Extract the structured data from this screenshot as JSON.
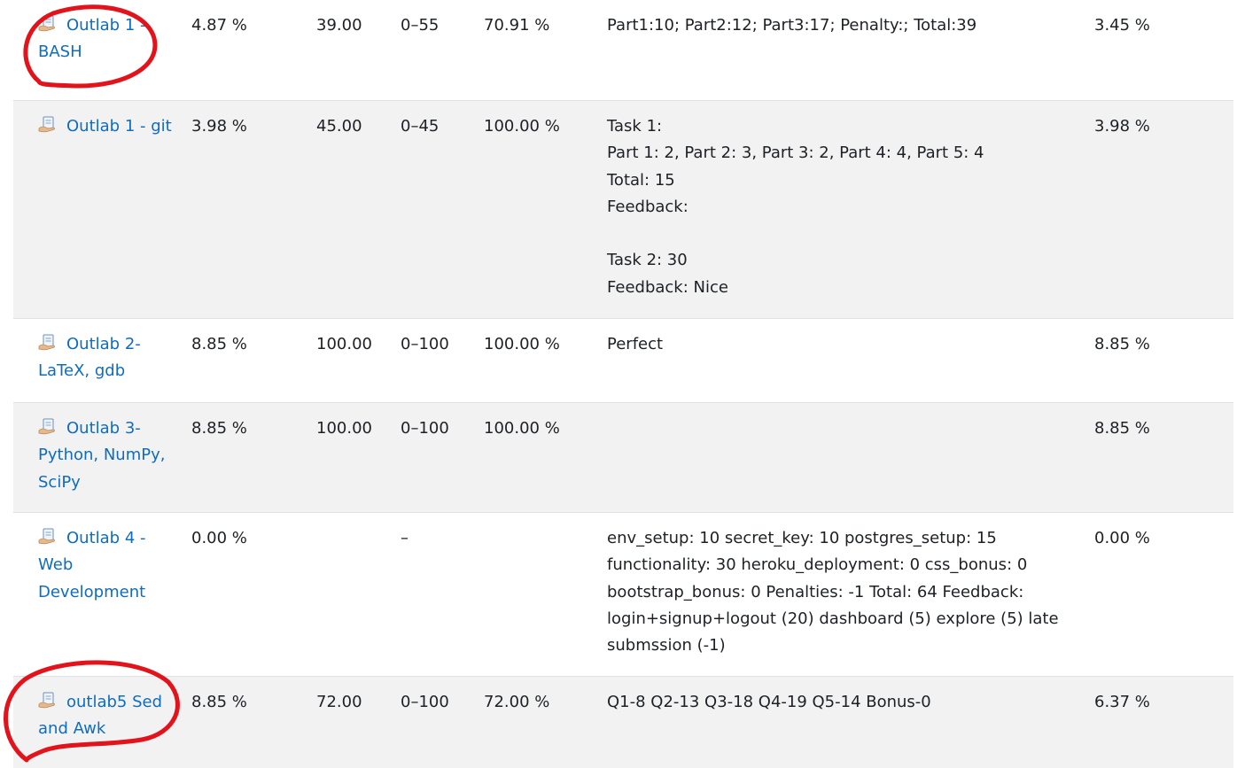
{
  "rows": [
    {
      "item": "Outlab 1 - BASH",
      "weight": "4.87 %",
      "grade": "39.00",
      "range": "0–55",
      "percentage": "70.91 %",
      "feedback": [
        "Part1:10; Part2:12; Part3:17; Penalty:; Total:39"
      ],
      "contribution": "3.45 %",
      "highlighted": true
    },
    {
      "item": "Outlab 1 - git",
      "weight": "3.98 %",
      "grade": "45.00",
      "range": "0–45",
      "percentage": "100.00 %",
      "feedback": [
        "Task 1:",
        "Part 1: 2, Part 2: 3, Part 3: 2, Part 4: 4, Part 5: 4",
        "Total: 15",
        "Feedback:",
        "",
        "Task 2: 30",
        "Feedback: Nice"
      ],
      "contribution": "3.98 %",
      "highlighted": false
    },
    {
      "item": "Outlab 2- LaTeX, gdb",
      "weight": "8.85 %",
      "grade": "100.00",
      "range": "0–100",
      "percentage": "100.00 %",
      "feedback": [
        "Perfect"
      ],
      "contribution": "8.85 %",
      "highlighted": false
    },
    {
      "item": "Outlab 3- Python, NumPy, SciPy",
      "weight": "8.85 %",
      "grade": "100.00",
      "range": "0–100",
      "percentage": "100.00 %",
      "feedback": [],
      "contribution": "8.85 %",
      "highlighted": false
    },
    {
      "item": "Outlab 4 - Web Development",
      "weight": "0.00 %",
      "grade": "",
      "range": "–",
      "percentage": "",
      "feedback": [
        "env_setup: 10 secret_key: 10 postgres_setup: 15 functionality: 30 heroku_deployment: 0 css_bonus: 0 bootstrap_bonus: 0 Penalties: -1 Total: 64 Feedback: login+signup+logout (20) dashboard (5) explore (5) late submssion (-1)"
      ],
      "contribution": "0.00 %",
      "highlighted": false
    },
    {
      "item": "outlab5 Sed and Awk",
      "weight": "8.85 %",
      "grade": "72.00",
      "range": "0–100",
      "percentage": "72.00 %",
      "feedback": [
        "Q1-8 Q2-13 Q3-18 Q4-19 Q5-14 Bonus-0"
      ],
      "contribution": "6.37 %",
      "highlighted": true
    }
  ],
  "colors": {
    "link": "#0f6cbf",
    "row_shade": "#f2f2f2",
    "annotation": "#e3131b"
  },
  "icons": {
    "item": "assignment-icon"
  }
}
